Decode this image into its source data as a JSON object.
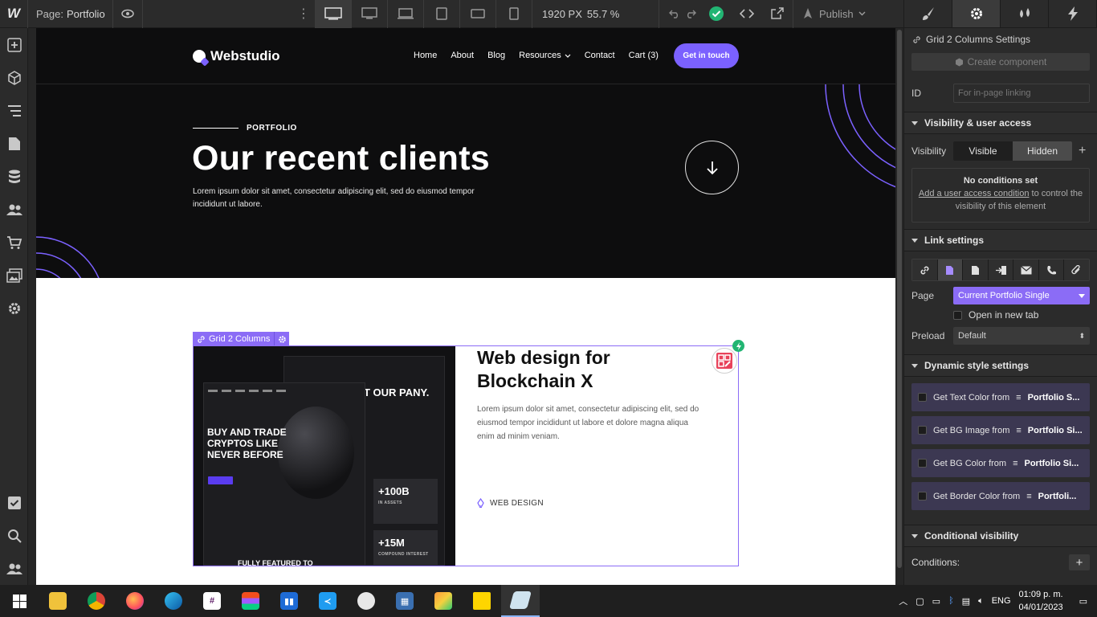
{
  "toolbar": {
    "page_prefix": "Page:",
    "page_name": "Portfolio",
    "width": "1920 PX",
    "zoom": "55.7 %",
    "publish": "Publish"
  },
  "canvas": {
    "header": {
      "brand": "Webstudio",
      "nav": [
        "Home",
        "About",
        "Blog",
        "Resources",
        "Contact",
        "Cart (3)"
      ],
      "cta": "Get in touch"
    },
    "hero": {
      "eyebrow": "PORTFOLIO",
      "title": "Our recent clients",
      "subtitle": "Lorem ipsum dolor sit amet, consectetur adipiscing elit, sed do eiusmod tempor incididunt ut labore."
    },
    "grid_tag": "Grid 2 Columns",
    "card": {
      "title": "Web design for Blockchain X",
      "text": "Lorem ipsum dolor sit amet, consectetur adipiscing elit, sed do eiusmod tempor incididunt ut labore et dolore magna aliqua enim ad minim veniam.",
      "tag": "WEB DESIGN",
      "mock": {
        "headline": "BUY AND TRADE CRYPTOS LIKE NEVER BEFORE",
        "side_title": "T OUR PANY.",
        "stat1": "+100B",
        "stat1_label": "IN ASSETS",
        "stat2": "+15M",
        "stat2_label": "COMPOUND INTEREST",
        "footer": "FULLY FEATURED TO"
      }
    }
  },
  "panel": {
    "selected": "Grid 2 Columns Settings",
    "create_component": "Create component",
    "id_label": "ID",
    "id_placeholder": "For in-page linking",
    "visibility_section": "Visibility & user access",
    "visibility_label": "Visibility",
    "visible": "Visible",
    "hidden": "Hidden",
    "no_conditions": "No conditions set",
    "cond_link": "Add a user access condition",
    "cond_rest": " to control the visibility of this element",
    "link_section": "Link settings",
    "page_label": "Page",
    "page_value": "Current Portfolio Single",
    "new_tab": "Open in new tab",
    "preload_label": "Preload",
    "preload_value": "Default",
    "dynamic_section": "Dynamic style settings",
    "dynamic": [
      {
        "label": "Get Text Color from",
        "source": "Portfolio S..."
      },
      {
        "label": "Get BG Image from",
        "source": "Portfolio Si..."
      },
      {
        "label": "Get BG Color from",
        "source": "Portfolio Si..."
      },
      {
        "label": "Get Border Color from",
        "source": "Portfoli..."
      }
    ],
    "conditional_section": "Conditional visibility",
    "conditions_label": "Conditions:"
  },
  "taskbar": {
    "lang": "ENG",
    "time": "01:09 p. m.",
    "date": "04/01/2023"
  },
  "colors": {
    "accent": "#8b6cf6",
    "cta": "#7b61ff",
    "hero_bg": "#0d0d0e",
    "success": "#22b573"
  }
}
